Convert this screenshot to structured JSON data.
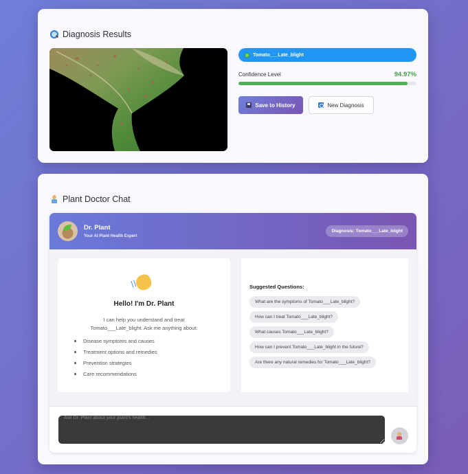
{
  "diagnosis_card": {
    "title": "Diagnosis Results",
    "title_icon": "magnifier-icon",
    "diagnosis": "Tomato___Late_blight",
    "diagnosis_icon": "microbe-icon",
    "confidence_label": "Confidence Level",
    "confidence_value": "94.97%",
    "confidence_fraction": 0.9497,
    "save_label": "Save to History",
    "new_label": "New Diagnosis",
    "colors": {
      "pill": "#2196f3",
      "bar": "#4caf50",
      "confidence_text": "#43a047"
    }
  },
  "chat_card": {
    "title": "Plant Doctor Chat",
    "title_icon": "doctor-icon",
    "bot_name": "Dr. Plant",
    "bot_subtitle": "Your AI Plant Health Expert",
    "diagnosis_chip": "Diagnosis: Tomato___Late_blight",
    "welcome": {
      "heading": "Hello! I'm Dr. Plant",
      "intro": "I can help you understand and treat Tomato___Late_blight. Ask me anything about:",
      "items": [
        "Disease symptoms and causes",
        "Treatment options and remedies",
        "Prevention strategies",
        "Care recommendations"
      ]
    },
    "suggestions_title": "Suggested Questions:",
    "suggestions": [
      "What are the symptoms of Tomato___Late_blight?",
      "How can I treat Tomato___Late_blight?",
      "What causes Tomato___Late_blight?",
      "How can I prevent Tomato___Late_blight in the future?",
      "Are there any natural remedies for Tomato___Late_blight?"
    ],
    "input_placeholder": "Ask Dr. Plant about your plant's health..."
  }
}
